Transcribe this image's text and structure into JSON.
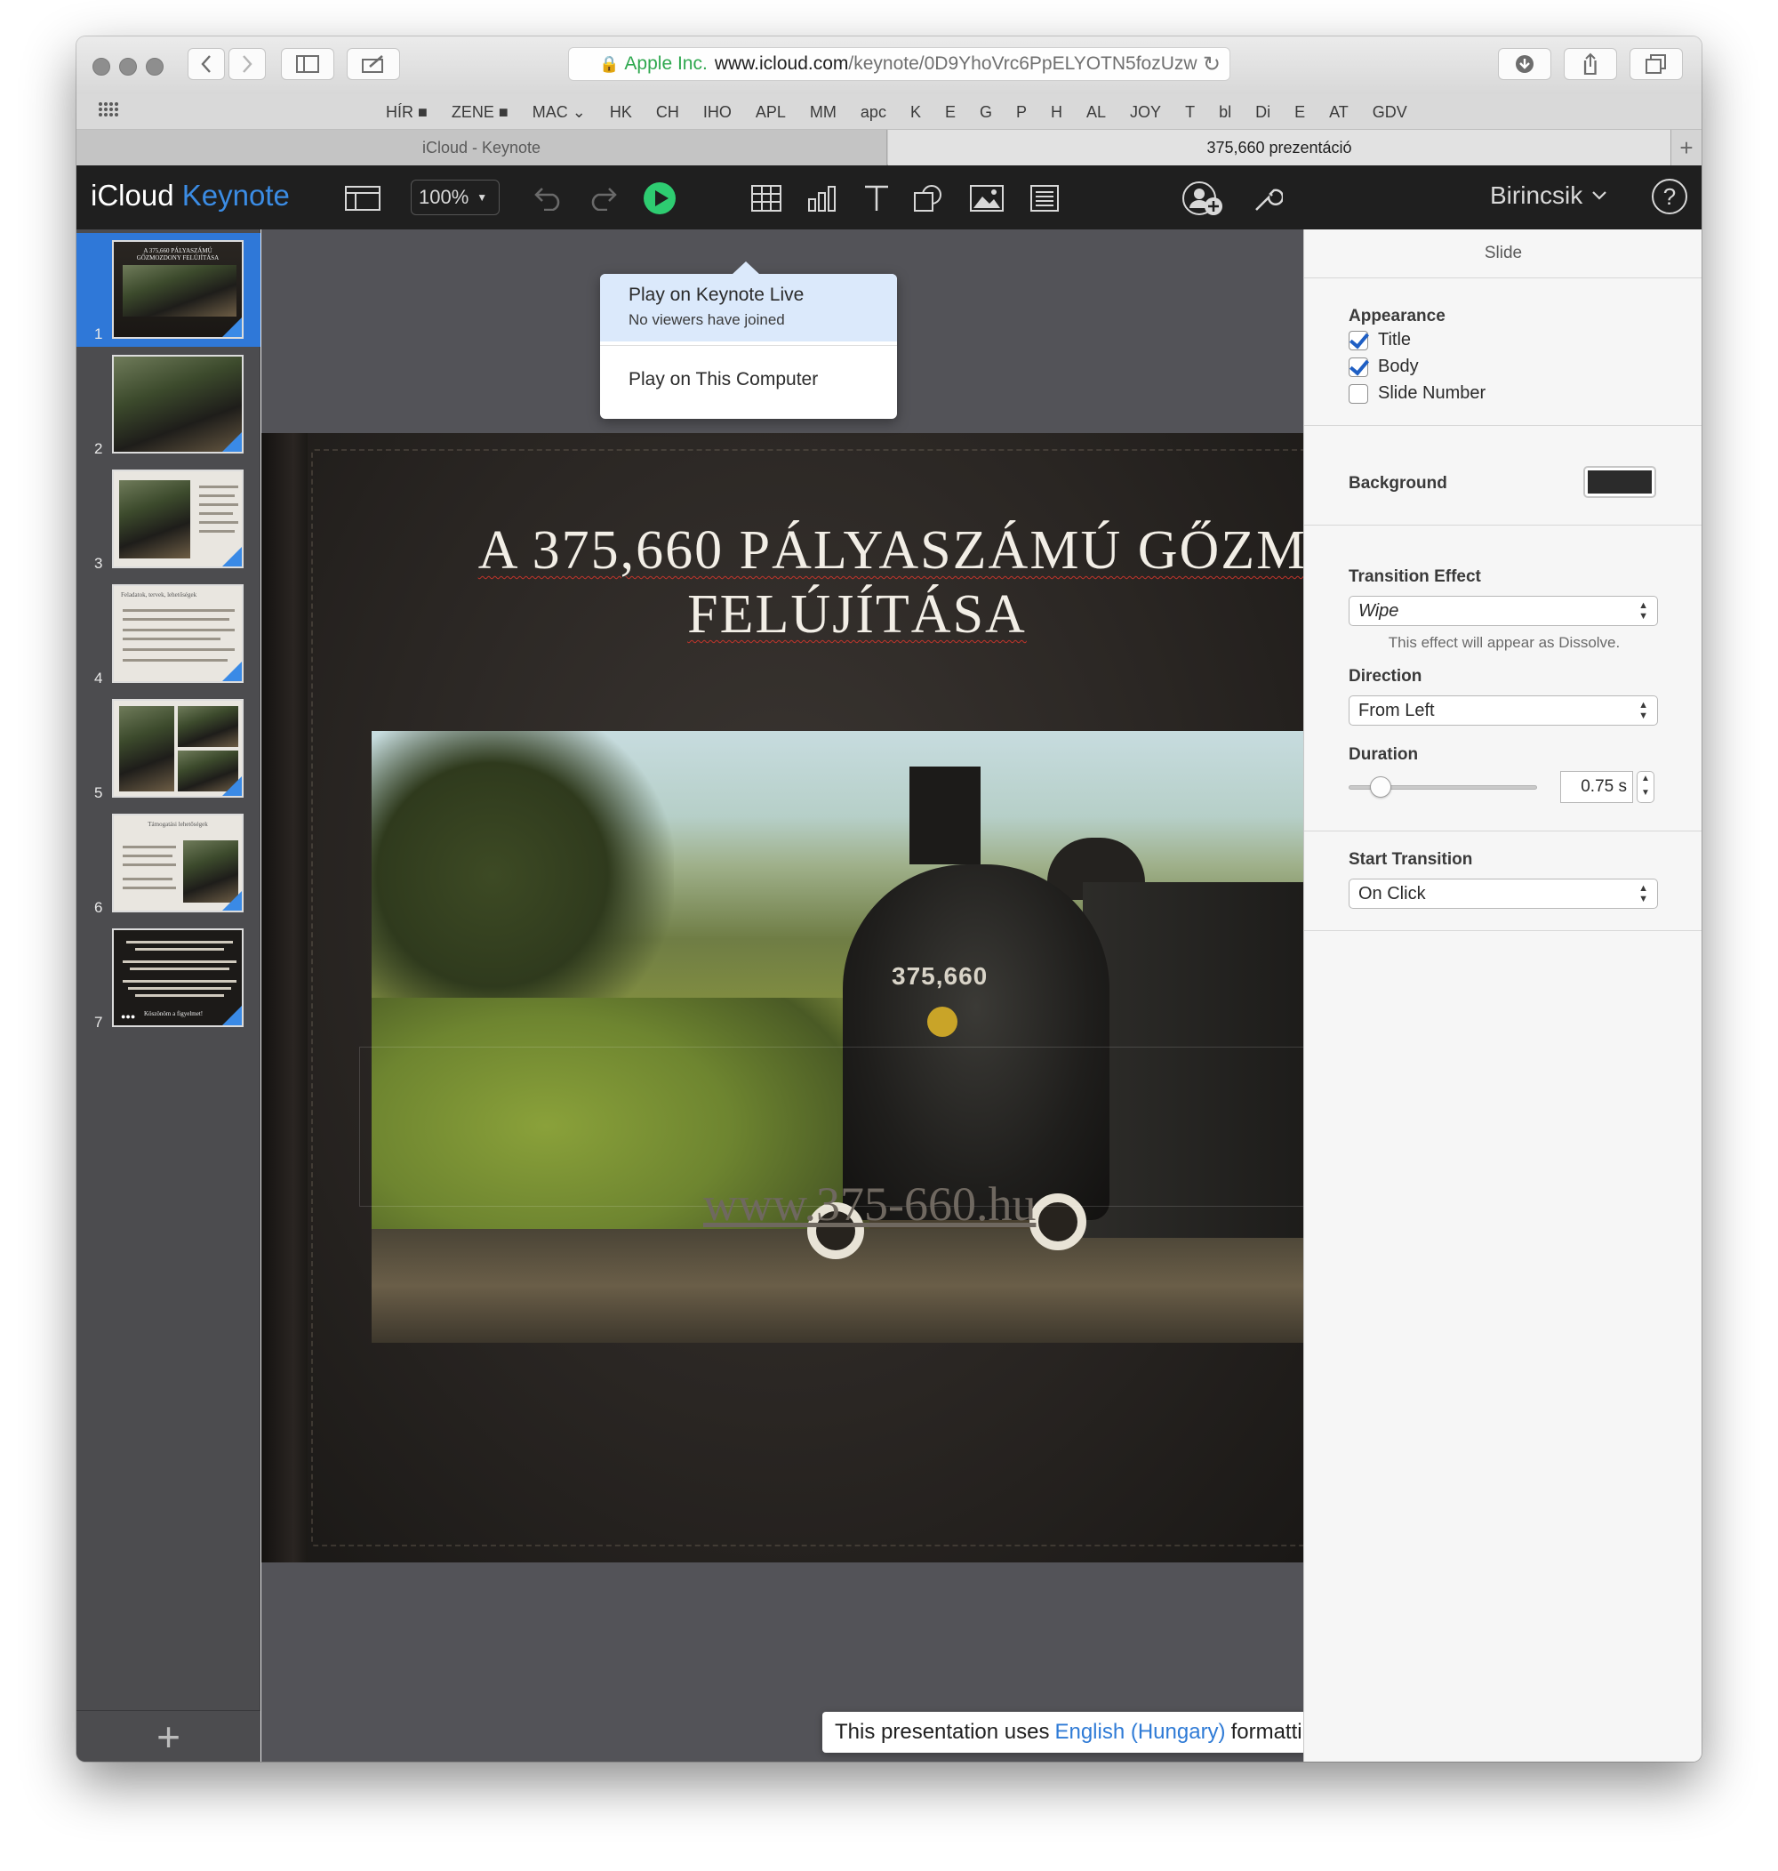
{
  "browser": {
    "url": {
      "org": "Apple Inc.",
      "host": "www.icloud.com",
      "path": "/keynote/0D9YhoVrc6PpELYOTN5fozUzw"
    },
    "favorites": [
      "HÍR ■",
      "ZENE ■",
      "MAC ⌄",
      "HK",
      "CH",
      "IHO",
      "APL",
      "MM",
      "apc",
      "K",
      "E",
      "G",
      "P",
      "H",
      "AL",
      "JOY",
      "T",
      "bl",
      "Di",
      "E",
      "AT",
      "GDV"
    ],
    "tabs": [
      {
        "label": "iCloud - Keynote",
        "active": false
      },
      {
        "label": "375,660 prezentáció",
        "active": true
      }
    ]
  },
  "keynote": {
    "brand_prefix": "iCloud",
    "brand_app": "Keynote",
    "zoom": "100%",
    "user": "Birincsik",
    "help": "?"
  },
  "navigator": {
    "slides": [
      {
        "number": "1",
        "thumb_title": "A 375,660 PÁLYASZÁMÚ GŐZMOZDONY FELÚJÍTÁSA"
      },
      {
        "number": "2"
      },
      {
        "number": "3"
      },
      {
        "number": "4",
        "thumb_title": "Feladatok, tervek, lehetőségek"
      },
      {
        "number": "5"
      },
      {
        "number": "6",
        "thumb_title": "Támogatási lehetőségek"
      },
      {
        "number": "7",
        "thumb_title": "Köszönöm a figyelmet!"
      }
    ],
    "add": "+"
  },
  "popover": {
    "live_title": "Play on Keynote Live",
    "live_sub": "No viewers have joined",
    "computer": "Play on This Computer"
  },
  "slide": {
    "title_line1": "A 375,660 PÁLYASZÁMÚ GŐZM",
    "title_line2": "FELÚJÍTÁSA",
    "plate": "375,660",
    "url": "www.375-660.hu"
  },
  "toast": {
    "prefix": "This presentation uses",
    "lang": "English (Hungary)",
    "suffix": "formatting.",
    "close": "×"
  },
  "inspector": {
    "header": "Slide",
    "appearance_label": "Appearance",
    "title_chk": "Title",
    "body_chk": "Body",
    "slide_number_chk": "Slide Number",
    "background_label": "Background",
    "background_color": "#2b2b2b",
    "transition_label": "Transition Effect",
    "transition_value": "Wipe",
    "transition_hint": "This effect will appear as Dissolve.",
    "direction_label": "Direction",
    "direction_value": "From Left",
    "duration_label": "Duration",
    "duration_value": "0.75 s",
    "start_label": "Start Transition",
    "start_value": "On Click"
  }
}
